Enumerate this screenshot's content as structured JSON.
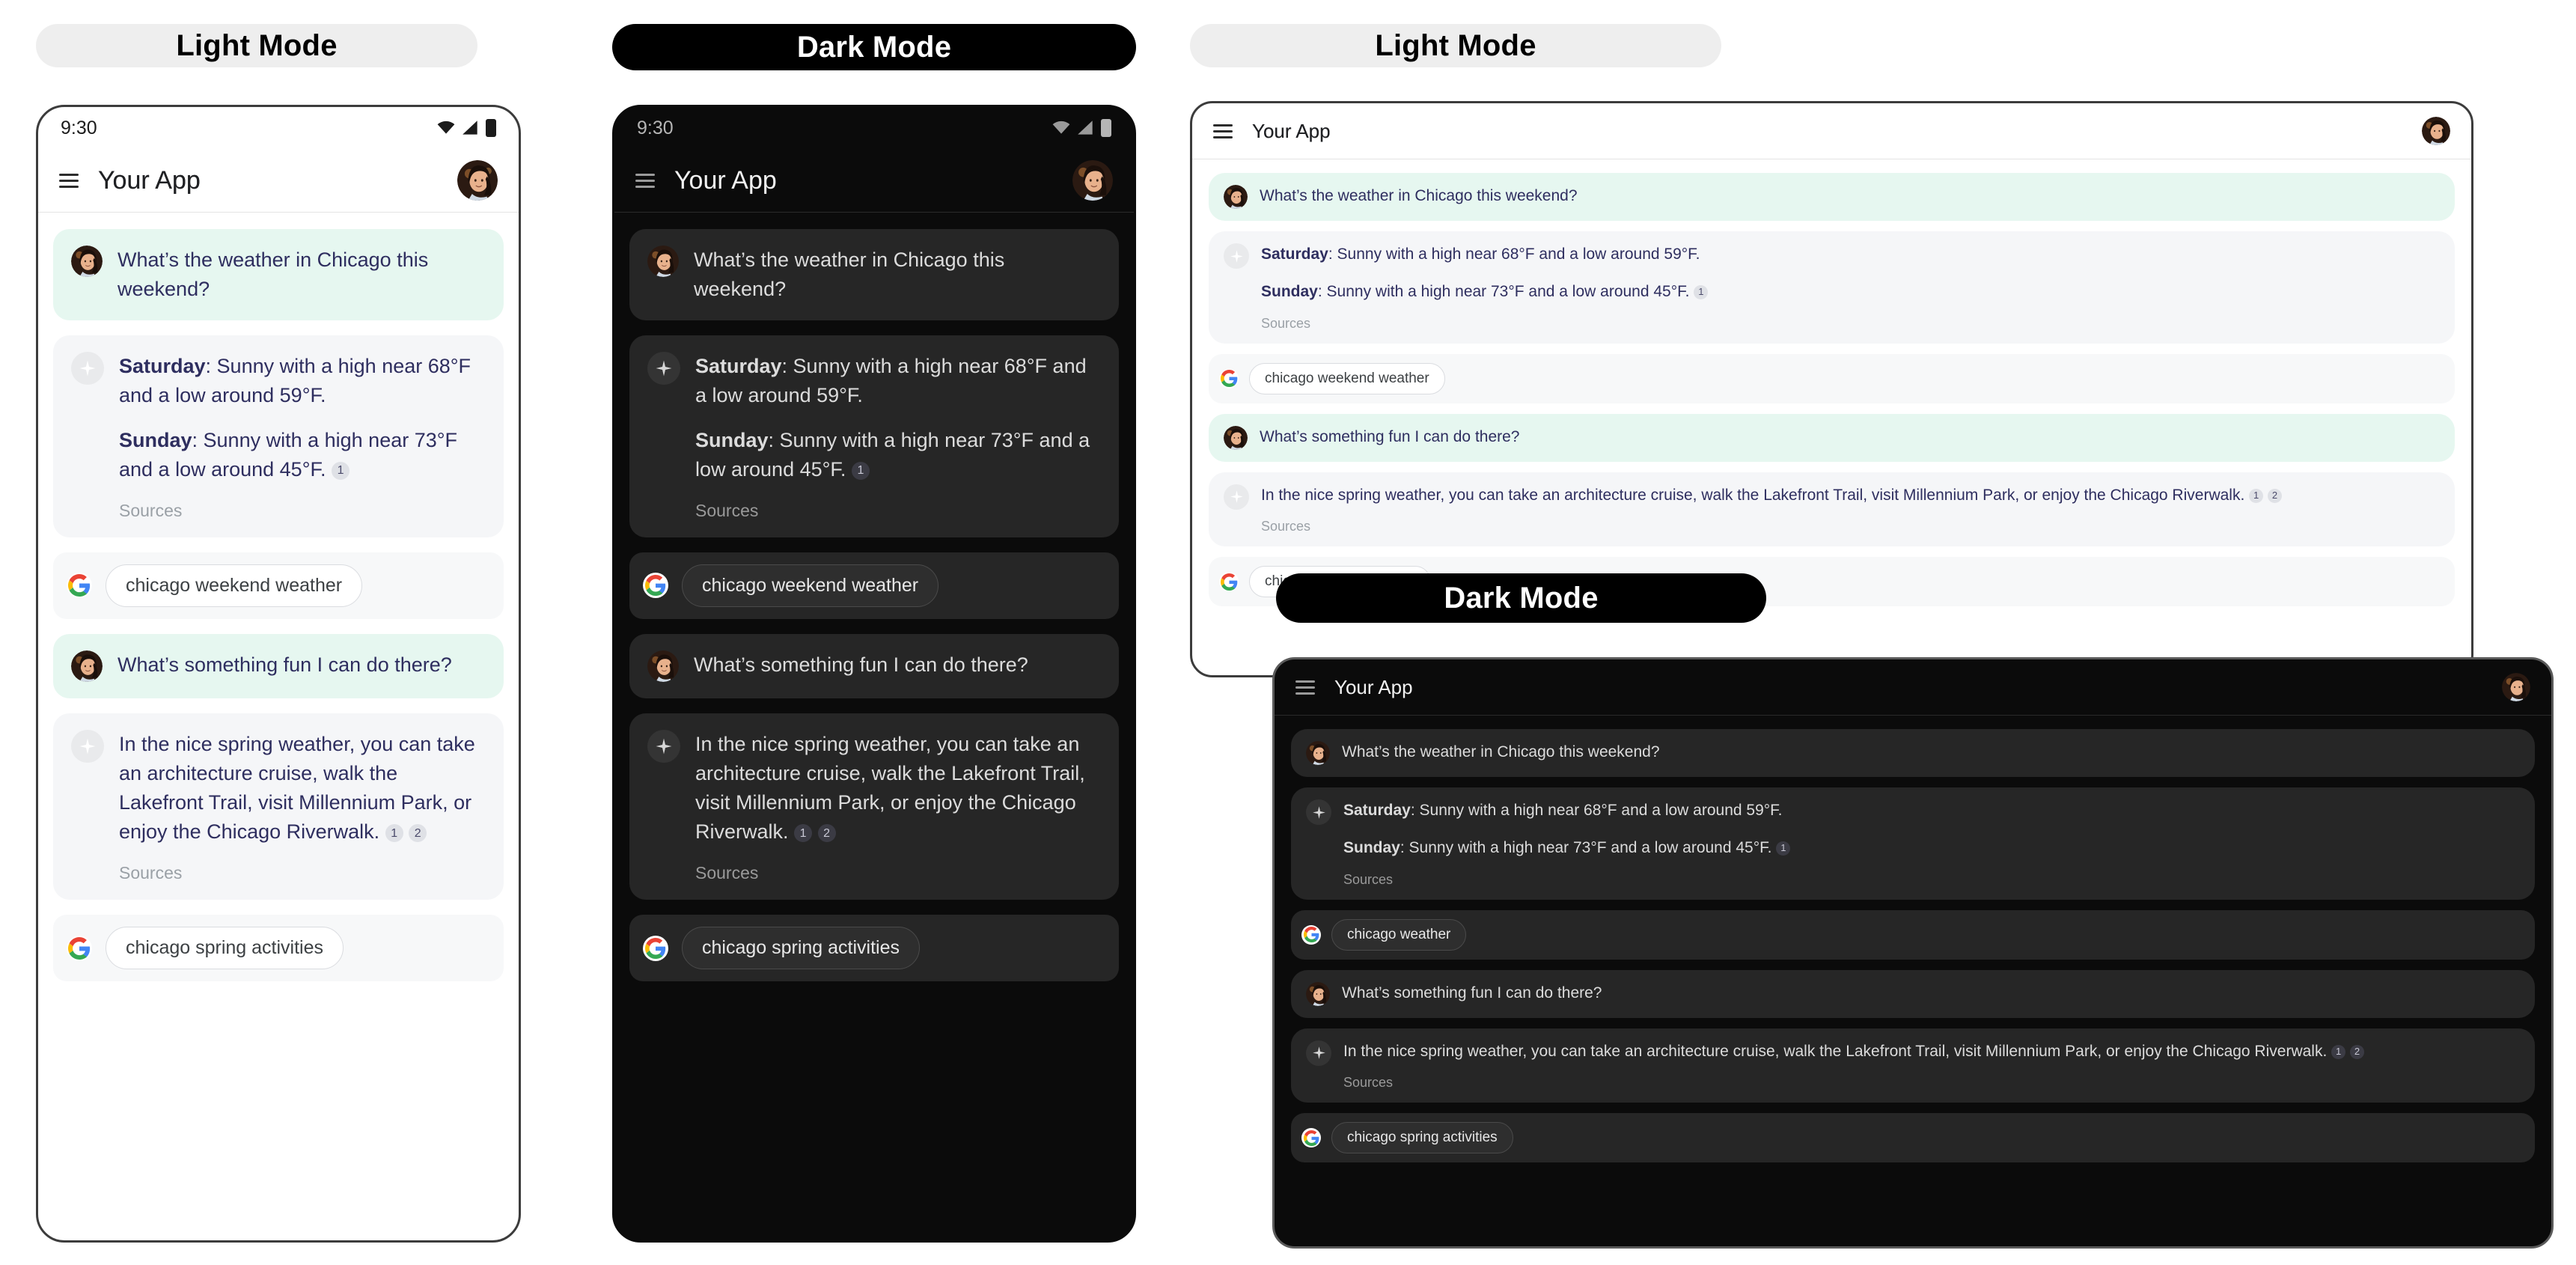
{
  "panels": {
    "phone_light_label": "Light Mode",
    "phone_dark_label": "Dark Mode",
    "tablet_light_label": "Light Mode",
    "tablet_dark_label": "Dark Mode"
  },
  "status": {
    "time": "9:30",
    "wifi_icon": "wifi-icon",
    "signal_icon": "cellular-signal-icon",
    "battery_icon": "battery-icon"
  },
  "appbar": {
    "menu_icon": "hamburger-menu-icon",
    "title": "Your App",
    "avatar_icon": "user-avatar"
  },
  "conversation": {
    "q1": "What’s the weather in Chicago this weekend?",
    "a1_sat_label": "Saturday",
    "a1_sat_text": ": Sunny with a high near 68°F and a low around 59°F.",
    "a1_sun_label": "Sunday",
    "a1_sun_text": ": Sunny with a high near 73°F and a low around 45°F.",
    "a1_cite_1": "1",
    "sources_label": "Sources",
    "chip1_light_phone": "chicago weekend weather",
    "chip1_dark_phone": "chicago weekend weather",
    "chip1_light_tablet": "chicago weekend weather",
    "chip1_dark_tablet": "chicago weather",
    "q2": "What’s something fun I can do there?",
    "a2_text": "In the nice spring weather, you can take an architecture cruise, walk the Lakefront Trail, visit Millennium Park, or enjoy the Chicago Riverwalk.",
    "a2_cite_1": "1",
    "a2_cite_2": "2",
    "chip2": "chicago spring activities",
    "google_icon": "google-g-logo",
    "sparkle_icon": "ai-sparkle-icon"
  },
  "colors": {
    "user_bubble_light": "#e6f7f0",
    "ai_bubble_light": "#f5f6f8",
    "bubble_dark": "#262626",
    "text_light": "#2e2e5f",
    "text_dark": "#dcdcdc",
    "pill_light_bg": "#eeeeee",
    "pill_dark_bg": "#000000",
    "device_border": "#3c3c3c"
  }
}
